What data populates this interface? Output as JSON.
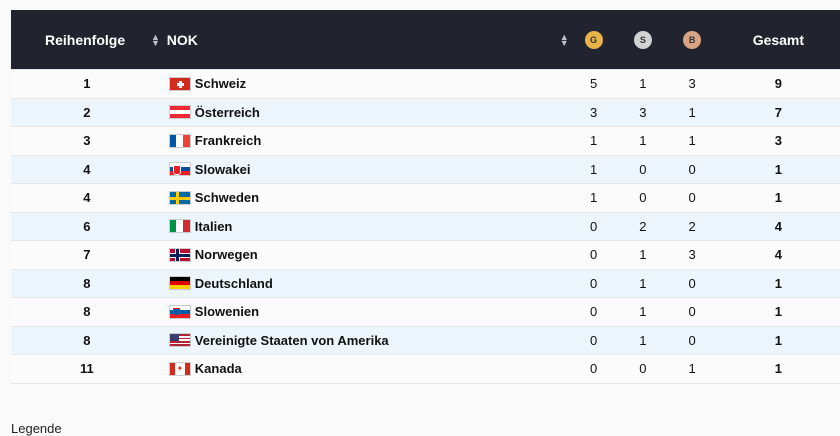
{
  "header": {
    "rank_label": "Reihenfolge",
    "nok_label": "NOK",
    "gold_label": "G",
    "silver_label": "S",
    "bronze_label": "B",
    "total_label": "Gesamt"
  },
  "colors": {
    "header_bg": "#21232f",
    "gold": "#e8b44a",
    "silver": "#d2d2d2",
    "bronze": "#d8a584",
    "row_alt": "#ebf5fb"
  },
  "rows": [
    {
      "rank": "1",
      "nok": "Schweiz",
      "flag": "flag-switzerland",
      "g": "5",
      "s": "1",
      "b": "3",
      "total": "9"
    },
    {
      "rank": "2",
      "nok": "Österreich",
      "flag": "flag-austria",
      "g": "3",
      "s": "3",
      "b": "1",
      "total": "7"
    },
    {
      "rank": "3",
      "nok": "Frankreich",
      "flag": "flag-france",
      "g": "1",
      "s": "1",
      "b": "1",
      "total": "3"
    },
    {
      "rank": "4",
      "nok": "Slowakei",
      "flag": "flag-slovakia",
      "g": "1",
      "s": "0",
      "b": "0",
      "total": "1"
    },
    {
      "rank": "4",
      "nok": "Schweden",
      "flag": "flag-sweden",
      "g": "1",
      "s": "0",
      "b": "0",
      "total": "1"
    },
    {
      "rank": "6",
      "nok": "Italien",
      "flag": "flag-italy",
      "g": "0",
      "s": "2",
      "b": "2",
      "total": "4"
    },
    {
      "rank": "7",
      "nok": "Norwegen",
      "flag": "flag-norway",
      "g": "0",
      "s": "1",
      "b": "3",
      "total": "4"
    },
    {
      "rank": "8",
      "nok": "Deutschland",
      "flag": "flag-germany",
      "g": "0",
      "s": "1",
      "b": "0",
      "total": "1"
    },
    {
      "rank": "8",
      "nok": "Slowenien",
      "flag": "flag-slovenia",
      "g": "0",
      "s": "1",
      "b": "0",
      "total": "1"
    },
    {
      "rank": "8",
      "nok": "Vereinigte Staaten von Amerika",
      "flag": "flag-usa",
      "g": "0",
      "s": "1",
      "b": "0",
      "total": "1"
    },
    {
      "rank": "11",
      "nok": "Kanada",
      "flag": "flag-canada",
      "g": "0",
      "s": "0",
      "b": "1",
      "total": "1"
    }
  ],
  "legend_label": "Legende"
}
